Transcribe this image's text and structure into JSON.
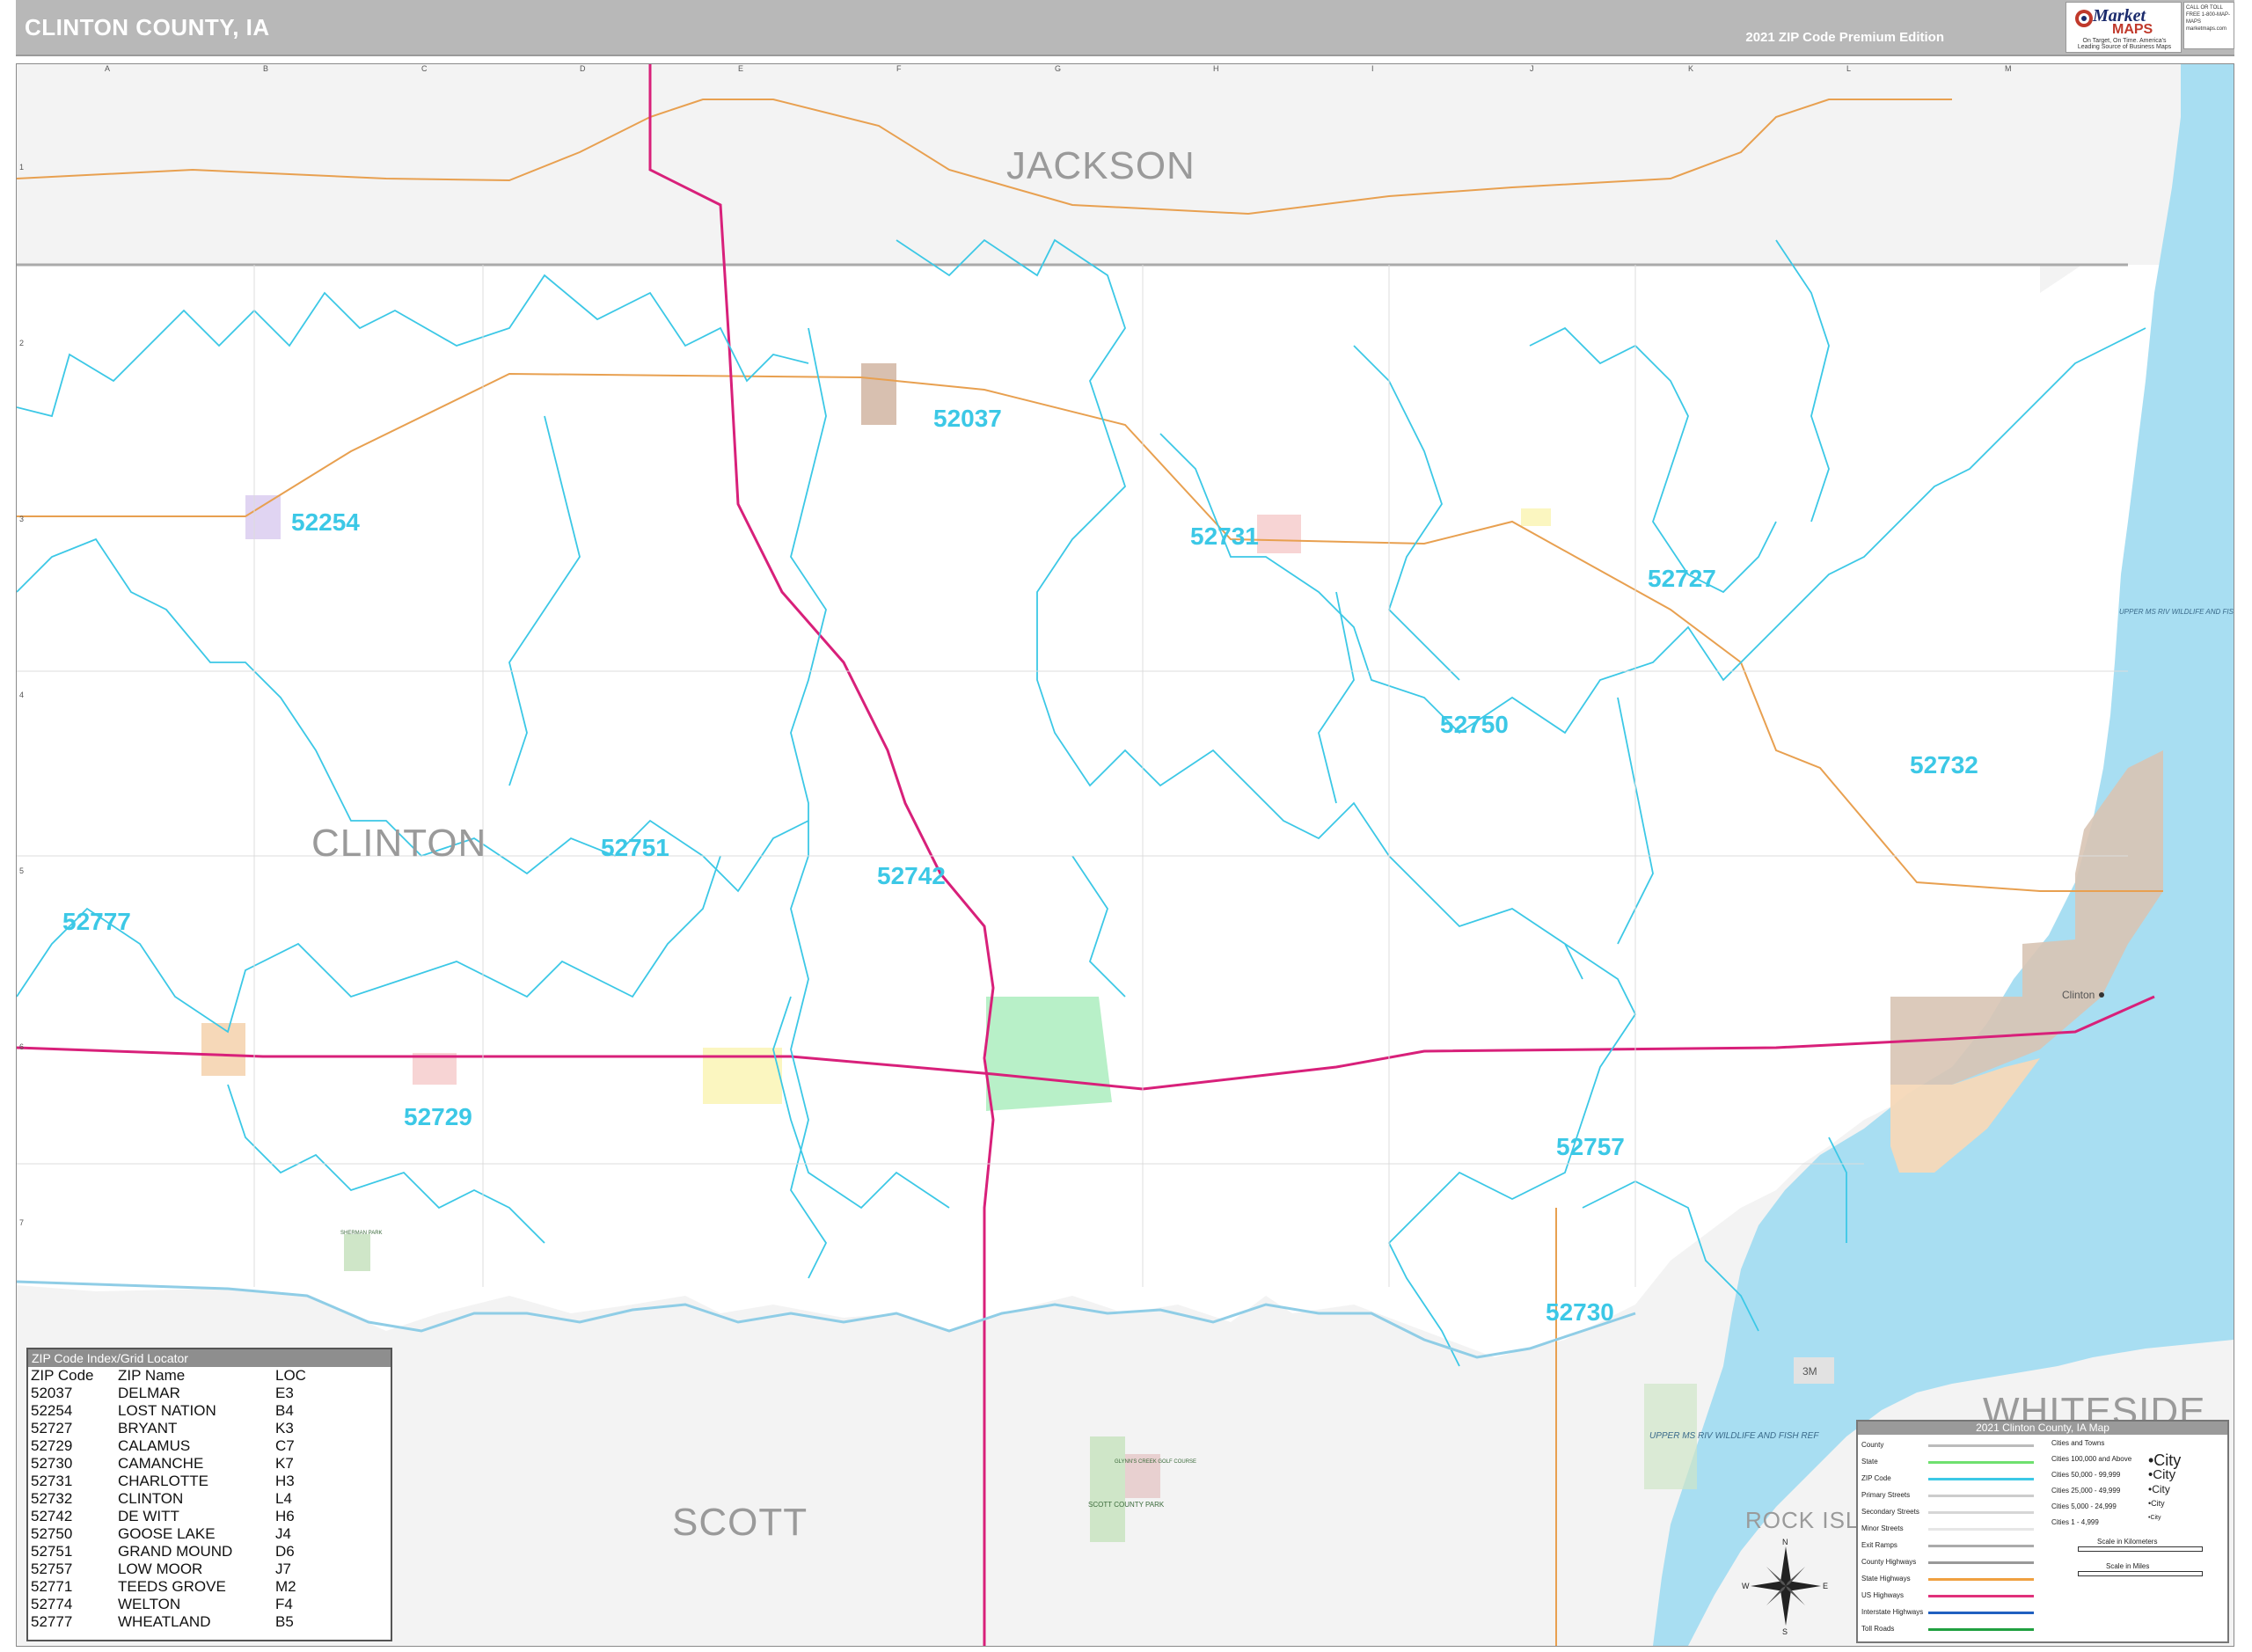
{
  "header": {
    "title": "CLINTON COUNTY, IA",
    "edition": "2021 ZIP Code Premium Edition",
    "logo_line1": "Market",
    "logo_line2": "MAPS",
    "logo_tagline": "On Target, On Time. America's Leading Source of Business Maps",
    "logo_contact": "CALL OR TOLL FREE 1-800-MAP-MAPS marketmaps.com"
  },
  "grid": {
    "columns": [
      "A",
      "B",
      "C",
      "D",
      "E",
      "F",
      "G",
      "H",
      "I",
      "J",
      "K",
      "L",
      "M"
    ],
    "rows": [
      "1",
      "2",
      "3",
      "4",
      "5",
      "6",
      "7"
    ]
  },
  "county_labels": {
    "jackson": "JACKSON",
    "clinton": "CLINTON",
    "scott": "SCOTT",
    "whiteside": "WHITESIDE",
    "rock_island": "ROCK ISL"
  },
  "zip_labels": {
    "z52037": "52037",
    "z52254": "52254",
    "z52731": "52731",
    "z52727": "52727",
    "z52750": "52750",
    "z52732": "52732",
    "z52751": "52751",
    "z52742": "52742",
    "z52777": "52777",
    "z52729": "52729",
    "z52757": "52757",
    "z52730": "52730"
  },
  "place_labels": {
    "clinton_city": "Clinton",
    "route_3m": "3M"
  },
  "area_labels": {
    "upper_ms_north": "UPPER MS RIV WILDLIFE AND FISH REF",
    "upper_ms_south": "UPPER MS RIV WILDLIFE AND FISH REF",
    "scott_county_park": "SCOTT COUNTY PARK",
    "glynns_creek": "GLYNN'S CREEK GOLF COURSE",
    "sherman_park": "SHERMAN PARK"
  },
  "zip_index": {
    "title": "ZIP Code Index/Grid Locator",
    "headers": [
      "ZIP Code",
      "ZIP Name",
      "LOC"
    ],
    "rows": [
      [
        "52037",
        "DELMAR",
        "E3"
      ],
      [
        "52254",
        "LOST NATION",
        "B4"
      ],
      [
        "52727",
        "BRYANT",
        "K3"
      ],
      [
        "52729",
        "CALAMUS",
        "C7"
      ],
      [
        "52730",
        "CAMANCHE",
        "K7"
      ],
      [
        "52731",
        "CHARLOTTE",
        "H3"
      ],
      [
        "52732",
        "CLINTON",
        "L4"
      ],
      [
        "52742",
        "DE WITT",
        "H6"
      ],
      [
        "52750",
        "GOOSE LAKE",
        "J4"
      ],
      [
        "52751",
        "GRAND MOUND",
        "D6"
      ],
      [
        "52757",
        "LOW MOOR",
        "J7"
      ],
      [
        "52771",
        "TEEDS GROVE",
        "M2"
      ],
      [
        "52774",
        "WELTON",
        "F4"
      ],
      [
        "52777",
        "WHEATLAND",
        "B5"
      ]
    ]
  },
  "legend": {
    "title": "2021 Clinton County, IA Map",
    "line_items": [
      {
        "label": "County",
        "color": "#bbbbbb"
      },
      {
        "label": "State",
        "color": "#6fe06f"
      },
      {
        "label": "ZIP Code",
        "color": "#3cc8e6"
      },
      {
        "label": "Primary Streets",
        "color": "#cccccc"
      },
      {
        "label": "Secondary Streets",
        "color": "#d6d6d6"
      },
      {
        "label": "Minor Streets",
        "color": "#e6e6e6"
      },
      {
        "label": "Exit Ramps",
        "color": "#aaaaaa"
      },
      {
        "label": "County Highways",
        "color": "#999999"
      },
      {
        "label": "State Highways",
        "color": "#f0a040"
      },
      {
        "label": "US Highways",
        "color": "#e0307a"
      },
      {
        "label": "Interstate Highways",
        "color": "#2060c0"
      },
      {
        "label": "Toll Roads",
        "color": "#20a040"
      }
    ],
    "city_header": "Cities and Towns",
    "city_items": [
      {
        "label": "Cities 100,000 and Above",
        "sample": "•City"
      },
      {
        "label": "Cities 50,000 - 99,999",
        "sample": "•City"
      },
      {
        "label": "Cities 25,000 - 49,999",
        "sample": "•City"
      },
      {
        "label": "Cities 5,000 - 24,999",
        "sample": "•City"
      },
      {
        "label": "Cities 1 - 4,999",
        "sample": "•City"
      }
    ],
    "scale_km": "Scale in Kilometers",
    "scale_mi": "Scale in Miles"
  },
  "compass": {
    "n": "N",
    "s": "S",
    "e": "E",
    "w": "W"
  },
  "colors": {
    "zip_boundary": "#3cc8e6",
    "us_highway": "#d8207a",
    "state_highway": "#e8a050",
    "water": "#a8def2",
    "outside_county": "#f3f3f3",
    "city_clinton": "#d8c4b4",
    "city_camanche": "#f6d8b8",
    "city_dewitt": "#b8f0c8"
  }
}
